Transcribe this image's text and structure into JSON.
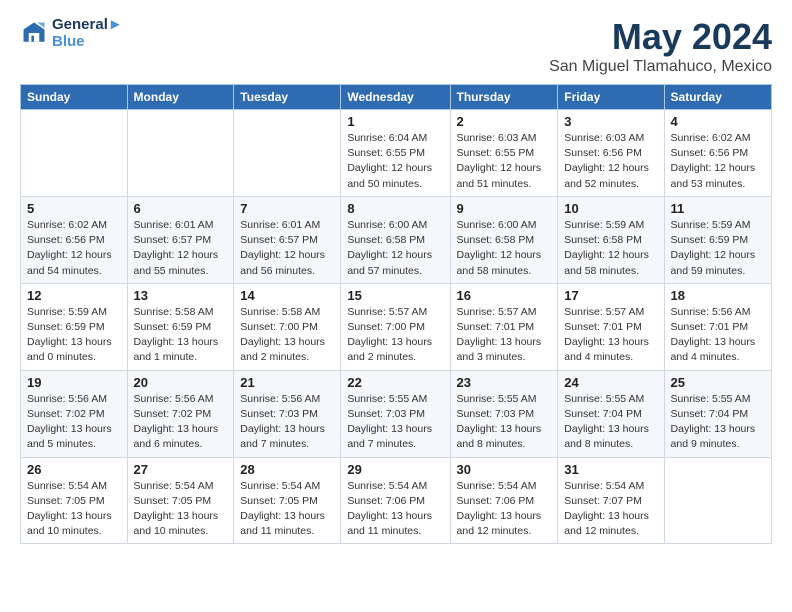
{
  "logo": {
    "line1": "General",
    "line2": "Blue"
  },
  "title": "May 2024",
  "subtitle": "San Miguel Tlamahuco, Mexico",
  "days_of_week": [
    "Sunday",
    "Monday",
    "Tuesday",
    "Wednesday",
    "Thursday",
    "Friday",
    "Saturday"
  ],
  "weeks": [
    [
      {
        "day": "",
        "info": ""
      },
      {
        "day": "",
        "info": ""
      },
      {
        "day": "",
        "info": ""
      },
      {
        "day": "1",
        "info": "Sunrise: 6:04 AM\nSunset: 6:55 PM\nDaylight: 12 hours\nand 50 minutes."
      },
      {
        "day": "2",
        "info": "Sunrise: 6:03 AM\nSunset: 6:55 PM\nDaylight: 12 hours\nand 51 minutes."
      },
      {
        "day": "3",
        "info": "Sunrise: 6:03 AM\nSunset: 6:56 PM\nDaylight: 12 hours\nand 52 minutes."
      },
      {
        "day": "4",
        "info": "Sunrise: 6:02 AM\nSunset: 6:56 PM\nDaylight: 12 hours\nand 53 minutes."
      }
    ],
    [
      {
        "day": "5",
        "info": "Sunrise: 6:02 AM\nSunset: 6:56 PM\nDaylight: 12 hours\nand 54 minutes."
      },
      {
        "day": "6",
        "info": "Sunrise: 6:01 AM\nSunset: 6:57 PM\nDaylight: 12 hours\nand 55 minutes."
      },
      {
        "day": "7",
        "info": "Sunrise: 6:01 AM\nSunset: 6:57 PM\nDaylight: 12 hours\nand 56 minutes."
      },
      {
        "day": "8",
        "info": "Sunrise: 6:00 AM\nSunset: 6:58 PM\nDaylight: 12 hours\nand 57 minutes."
      },
      {
        "day": "9",
        "info": "Sunrise: 6:00 AM\nSunset: 6:58 PM\nDaylight: 12 hours\nand 58 minutes."
      },
      {
        "day": "10",
        "info": "Sunrise: 5:59 AM\nSunset: 6:58 PM\nDaylight: 12 hours\nand 58 minutes."
      },
      {
        "day": "11",
        "info": "Sunrise: 5:59 AM\nSunset: 6:59 PM\nDaylight: 12 hours\nand 59 minutes."
      }
    ],
    [
      {
        "day": "12",
        "info": "Sunrise: 5:59 AM\nSunset: 6:59 PM\nDaylight: 13 hours\nand 0 minutes."
      },
      {
        "day": "13",
        "info": "Sunrise: 5:58 AM\nSunset: 6:59 PM\nDaylight: 13 hours\nand 1 minute."
      },
      {
        "day": "14",
        "info": "Sunrise: 5:58 AM\nSunset: 7:00 PM\nDaylight: 13 hours\nand 2 minutes."
      },
      {
        "day": "15",
        "info": "Sunrise: 5:57 AM\nSunset: 7:00 PM\nDaylight: 13 hours\nand 2 minutes."
      },
      {
        "day": "16",
        "info": "Sunrise: 5:57 AM\nSunset: 7:01 PM\nDaylight: 13 hours\nand 3 minutes."
      },
      {
        "day": "17",
        "info": "Sunrise: 5:57 AM\nSunset: 7:01 PM\nDaylight: 13 hours\nand 4 minutes."
      },
      {
        "day": "18",
        "info": "Sunrise: 5:56 AM\nSunset: 7:01 PM\nDaylight: 13 hours\nand 4 minutes."
      }
    ],
    [
      {
        "day": "19",
        "info": "Sunrise: 5:56 AM\nSunset: 7:02 PM\nDaylight: 13 hours\nand 5 minutes."
      },
      {
        "day": "20",
        "info": "Sunrise: 5:56 AM\nSunset: 7:02 PM\nDaylight: 13 hours\nand 6 minutes."
      },
      {
        "day": "21",
        "info": "Sunrise: 5:56 AM\nSunset: 7:03 PM\nDaylight: 13 hours\nand 7 minutes."
      },
      {
        "day": "22",
        "info": "Sunrise: 5:55 AM\nSunset: 7:03 PM\nDaylight: 13 hours\nand 7 minutes."
      },
      {
        "day": "23",
        "info": "Sunrise: 5:55 AM\nSunset: 7:03 PM\nDaylight: 13 hours\nand 8 minutes."
      },
      {
        "day": "24",
        "info": "Sunrise: 5:55 AM\nSunset: 7:04 PM\nDaylight: 13 hours\nand 8 minutes."
      },
      {
        "day": "25",
        "info": "Sunrise: 5:55 AM\nSunset: 7:04 PM\nDaylight: 13 hours\nand 9 minutes."
      }
    ],
    [
      {
        "day": "26",
        "info": "Sunrise: 5:54 AM\nSunset: 7:05 PM\nDaylight: 13 hours\nand 10 minutes."
      },
      {
        "day": "27",
        "info": "Sunrise: 5:54 AM\nSunset: 7:05 PM\nDaylight: 13 hours\nand 10 minutes."
      },
      {
        "day": "28",
        "info": "Sunrise: 5:54 AM\nSunset: 7:05 PM\nDaylight: 13 hours\nand 11 minutes."
      },
      {
        "day": "29",
        "info": "Sunrise: 5:54 AM\nSunset: 7:06 PM\nDaylight: 13 hours\nand 11 minutes."
      },
      {
        "day": "30",
        "info": "Sunrise: 5:54 AM\nSunset: 7:06 PM\nDaylight: 13 hours\nand 12 minutes."
      },
      {
        "day": "31",
        "info": "Sunrise: 5:54 AM\nSunset: 7:07 PM\nDaylight: 13 hours\nand 12 minutes."
      },
      {
        "day": "",
        "info": ""
      }
    ]
  ]
}
